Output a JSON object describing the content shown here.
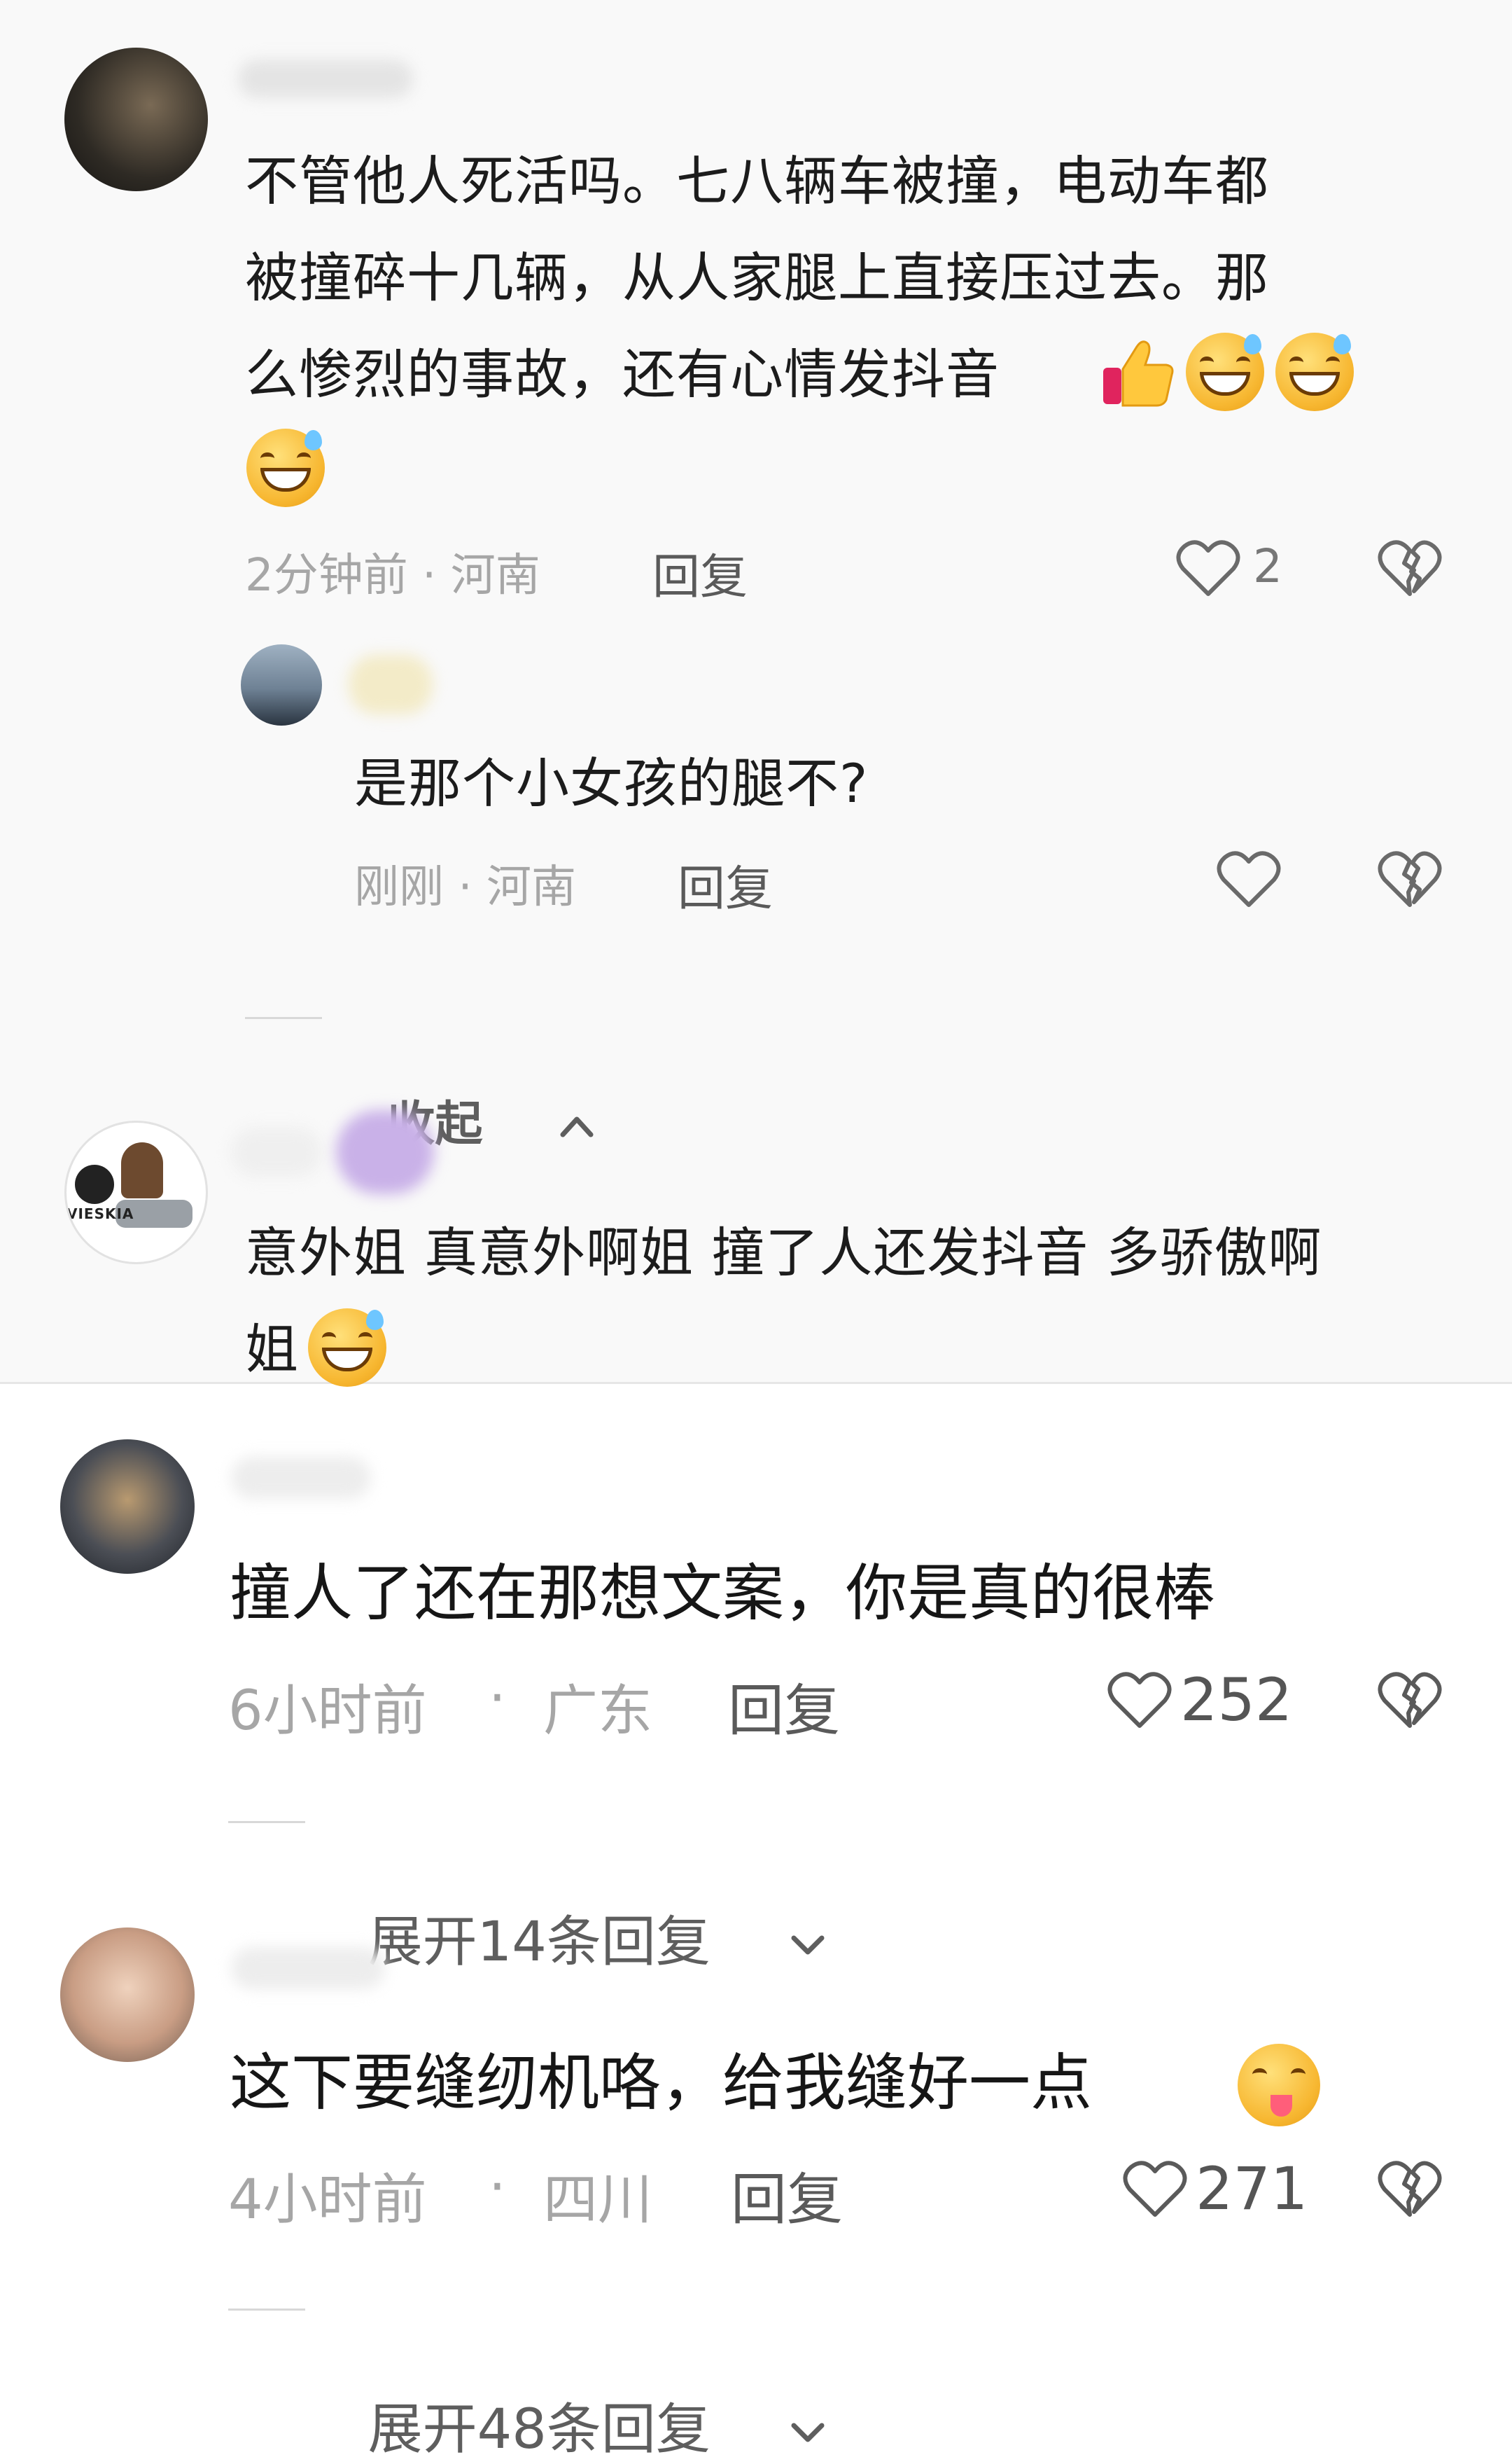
{
  "comments": [
    {
      "text": "不管他人死活吗。七八辆车被撞，电动车都\n被撞碎十几辆，从人家腿上直接压过去。那\n么惨烈的事故，还有心情发抖音",
      "meta": "2分钟前 · 河南",
      "reply_label": "回复",
      "likes": "2",
      "emoji_trail": [
        "thumbs-up-icon",
        "grinning-sweat-icon",
        "grinning-sweat-icon",
        "grinning-sweat-icon"
      ],
      "replies": [
        {
          "text": "是那个小女孩的腿不?",
          "meta": "刚刚 · 河南",
          "reply_label": "回复"
        }
      ],
      "collapse_label": "收起"
    },
    {
      "text": "意外姐 真意外啊姐 撞了人还发抖音 多骄傲啊\n姐",
      "avatar_caption": "VIESKIA",
      "emoji_trail": [
        "grinning-sweat-icon"
      ]
    },
    {
      "text": "撞人了还在那想文案，你是真的很棒",
      "meta_time": "6小时前",
      "meta_dot": "·",
      "meta_region": "广东",
      "reply_label": "回复",
      "likes": "252",
      "expand_label": "展开14条回复"
    },
    {
      "text": "这下要缝纫机咯，给我缝好一点",
      "meta_time": "4小时前",
      "meta_dot": "·",
      "meta_region": "四川",
      "reply_label": "回复",
      "likes": "271",
      "expand_label": "展开48条回复",
      "emoji_trail": [
        "yum-face-icon"
      ]
    }
  ],
  "colors": {
    "meta_gray": "#a6a6a6",
    "reply_gray": "#5a5a5a",
    "text": "#161616",
    "top_bg": "#f9f9f9",
    "bottom_bg": "#ffffff"
  }
}
